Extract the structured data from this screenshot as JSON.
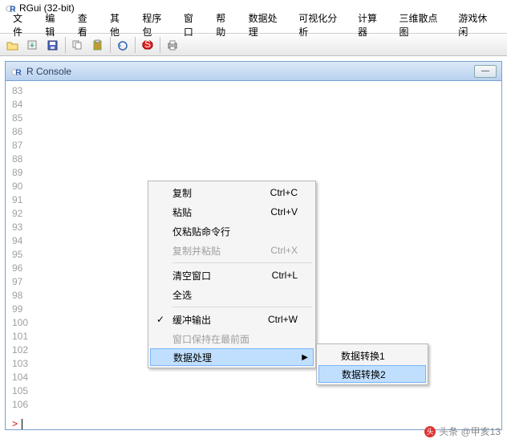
{
  "app": {
    "title": "RGui (32-bit)"
  },
  "menu": {
    "items": [
      "文件",
      "编辑",
      "查看",
      "其他",
      "程序包",
      "窗口",
      "帮助",
      "数据处理",
      "可视化分析",
      "计算器",
      "三维散点图",
      "游戏休闲"
    ]
  },
  "console": {
    "title": "R Console",
    "lines": [
      "83",
      "84",
      "85",
      "86",
      "87",
      "88",
      "89",
      "90",
      "91",
      "92",
      "93",
      "94",
      "95",
      "96",
      "97",
      "98",
      "99",
      "100",
      "101",
      "102",
      "103",
      "104",
      "105",
      "106"
    ],
    "prompt": ">"
  },
  "context_menu": {
    "copy": {
      "label": "复制",
      "shortcut": "Ctrl+C",
      "enabled": true
    },
    "paste": {
      "label": "粘贴",
      "shortcut": "Ctrl+V",
      "enabled": true
    },
    "paste_cmd": {
      "label": "仅粘贴命令行",
      "shortcut": "",
      "enabled": true
    },
    "copy_paste": {
      "label": "复制并粘贴",
      "shortcut": "Ctrl+X",
      "enabled": false
    },
    "clear": {
      "label": "清空窗口",
      "shortcut": "Ctrl+L",
      "enabled": true
    },
    "select_all": {
      "label": "全选",
      "shortcut": "",
      "enabled": true
    },
    "buffered": {
      "label": "缓冲输出",
      "shortcut": "Ctrl+W",
      "enabled": true,
      "checked": true
    },
    "ontop": {
      "label": "窗口保持在最前面",
      "shortcut": "",
      "enabled": false
    },
    "data": {
      "label": "数据处理",
      "shortcut": "",
      "enabled": true,
      "highlight": true
    }
  },
  "submenu": {
    "item1": {
      "label": "数据转换1"
    },
    "item2": {
      "label": "数据转换2",
      "highlight": true
    }
  },
  "watermark": {
    "text": "头条 @甲亥13"
  }
}
